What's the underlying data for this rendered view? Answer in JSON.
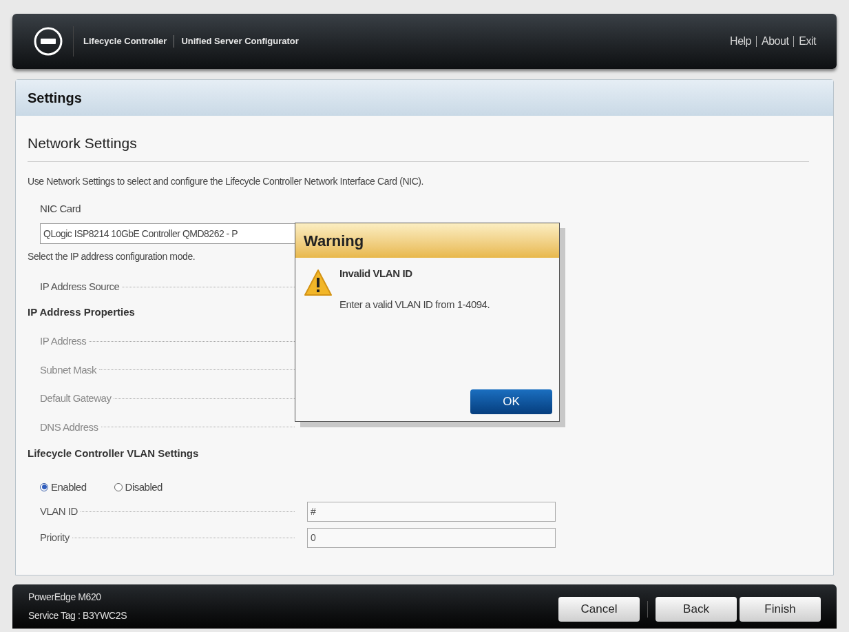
{
  "header": {
    "app_name": "Lifecycle Controller",
    "subtitle": "Unified Server Configurator",
    "links": [
      "Help",
      "About",
      "Exit"
    ]
  },
  "page_title": "Settings",
  "section_title": "Network Settings",
  "description": "Use Network Settings to select and configure the Lifecycle Controller Network Interface Card (NIC).",
  "nic": {
    "label": "NIC Card",
    "value": "QLogic ISP8214 10GbE Controller QMD8262 - P"
  },
  "mode_hint": "Select the IP address configuration mode.",
  "ip_source": {
    "label": "IP Address Source"
  },
  "ip_properties": {
    "heading": "IP Address Properties",
    "fields": [
      {
        "label": "IP Address"
      },
      {
        "label": "Subnet Mask"
      },
      {
        "label": "Default Gateway"
      },
      {
        "label": "DNS Address"
      }
    ]
  },
  "vlan": {
    "heading": "Lifecycle Controller VLAN Settings",
    "modes": [
      {
        "label": "Enabled",
        "selected": true
      },
      {
        "label": "Disabled",
        "selected": false
      }
    ],
    "fields": [
      {
        "label": "VLAN ID",
        "value": "#"
      },
      {
        "label": "Priority",
        "value": "0"
      }
    ]
  },
  "dialog": {
    "title": "Warning",
    "heading": "Invalid VLAN ID",
    "message": "Enter a valid VLAN ID from 1-4094.",
    "button": "OK"
  },
  "footer": {
    "model": "PowerEdge M620",
    "service_tag": "Service Tag : B3YWC2S",
    "buttons": [
      "Cancel",
      "Back",
      "Finish"
    ]
  }
}
